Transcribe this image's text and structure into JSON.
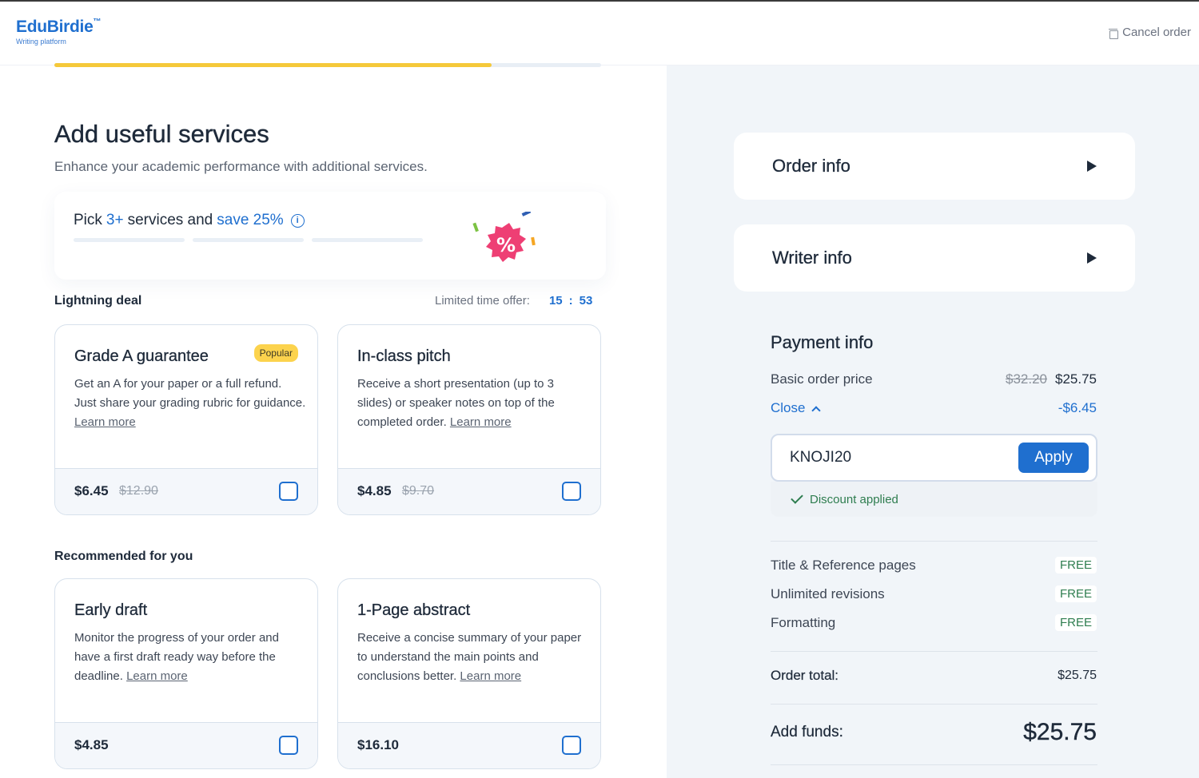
{
  "header": {
    "logo_name": "EduBirdie",
    "logo_tm": "™",
    "logo_sub": "Writing platform",
    "cancel_label": "Cancel order"
  },
  "progress": {
    "fraction": 0.8
  },
  "main": {
    "title": "Add useful services",
    "subtitle": "Enhance your academic performance with additional services.",
    "promo": {
      "pick": "Pick",
      "count": "3+",
      "services_and": "services and",
      "save": "save 25%",
      "info_icon": "i"
    },
    "lightning": {
      "label": "Lightning deal",
      "timer_label": "Limited time offer:",
      "minutes": "15",
      "separator": ":",
      "seconds": "53"
    },
    "recommended_label": "Recommended for you",
    "cards": [
      {
        "title": "Grade A guarantee",
        "badge": "Popular",
        "desc": "Get an A for your paper or a full refund. Just share your grading rubric for guidance.",
        "learn": "Learn more",
        "price": "$6.45",
        "old_price": "$12.90"
      },
      {
        "title": "In-class pitch",
        "desc": "Receive a short presentation (up to 3 slides) or speaker notes on top of the completed order.",
        "learn": "Learn more",
        "price": "$4.85",
        "old_price": "$9.70"
      },
      {
        "title": "Early draft",
        "desc": "Monitor the progress of your order and have a first draft ready way before the deadline.",
        "learn": "Learn more",
        "price": "$4.85"
      },
      {
        "title": "1-Page abstract",
        "desc": "Receive a concise summary of your paper to understand the main points and conclusions better.",
        "learn": "Learn more",
        "price": "$16.10"
      }
    ]
  },
  "sidebar": {
    "order_info": "Order info",
    "writer_info": "Writer info",
    "payment_title": "Payment info",
    "basic_label": "Basic order price",
    "basic_old": "$32.20",
    "basic_new": "$25.75",
    "close_label": "Close",
    "discount": "-$6.45",
    "promo_code": "KNOJI20",
    "apply_label": "Apply",
    "discount_applied": "Discount applied",
    "extras": [
      {
        "label": "Title & Reference pages",
        "value": "FREE"
      },
      {
        "label": "Unlimited revisions",
        "value": "FREE"
      },
      {
        "label": "Formatting",
        "value": "FREE"
      }
    ],
    "order_total_label": "Order total:",
    "order_total": "$25.75",
    "add_funds_label": "Add funds:",
    "add_funds": "$25.75"
  },
  "colors": {
    "accent": "#1f6fcf",
    "progress": "#f5c93a",
    "badge": "#fcd34d",
    "promo_badge": "#ee3f74",
    "success": "#2e7d4f"
  }
}
